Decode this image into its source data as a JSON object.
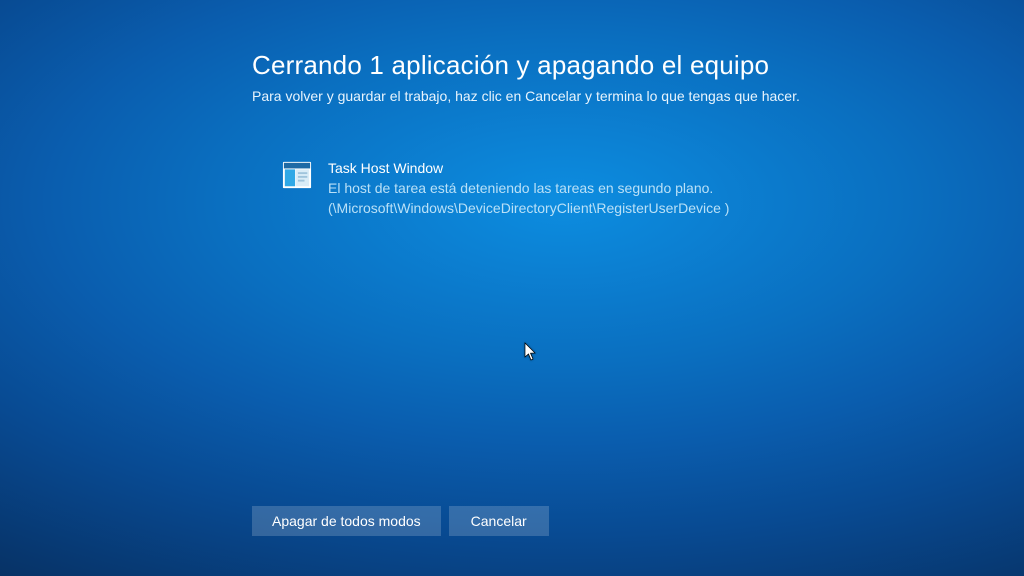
{
  "header": {
    "title": "Cerrando 1 aplicación y apagando el equipo",
    "subtitle": "Para volver y guardar el trabajo, haz clic en Cancelar y termina lo que tengas que hacer."
  },
  "app": {
    "name": "Task Host Window",
    "description": "El host de tarea está deteniendo las tareas en segundo plano.",
    "path": "(\\Microsoft\\Windows\\DeviceDirectoryClient\\RegisterUserDevice )",
    "icon": "window-app-icon"
  },
  "buttons": {
    "shutdown_label": "Apagar de todos modos",
    "cancel_label": "Cancelar"
  }
}
